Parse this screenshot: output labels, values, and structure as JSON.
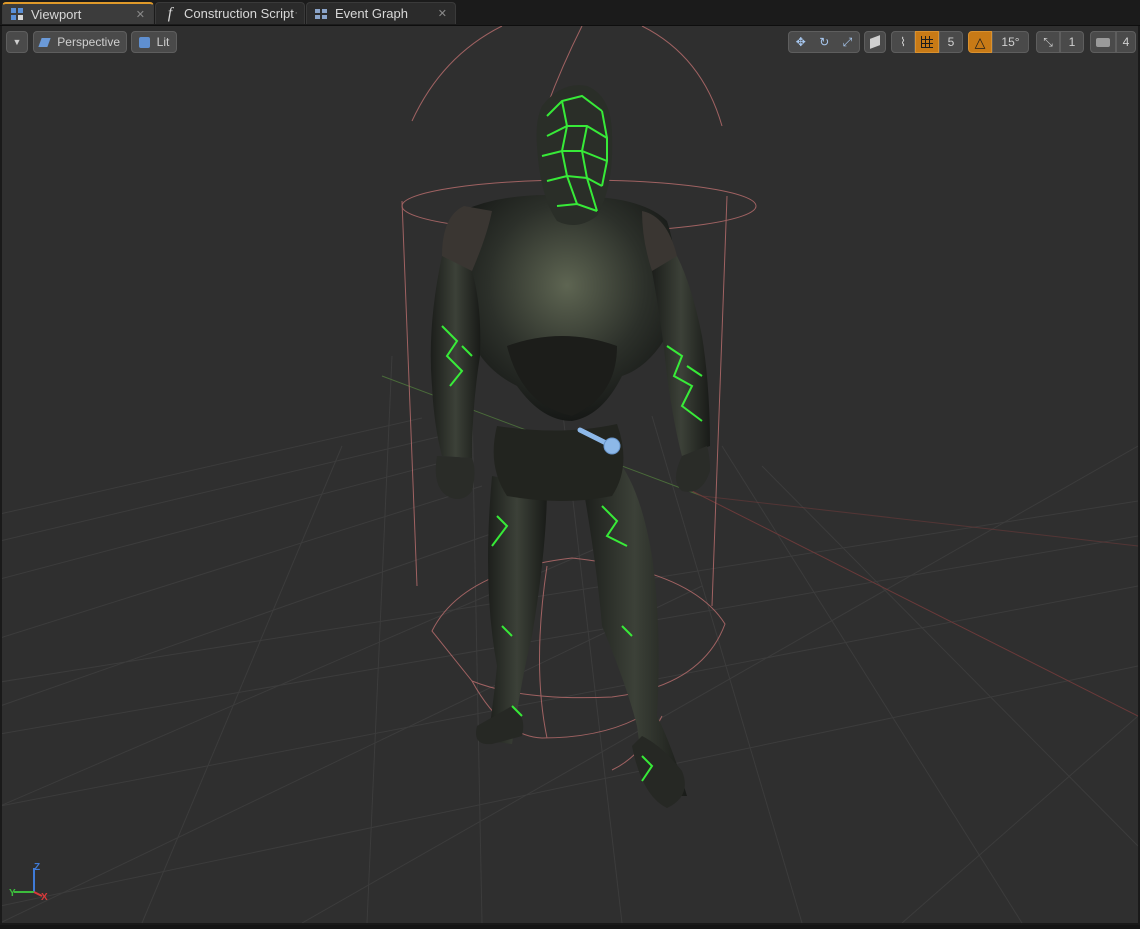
{
  "tabs": [
    {
      "label": "Viewport",
      "icon": "viewport-icon",
      "active": true
    },
    {
      "label": "Construction Script",
      "icon": "function-icon",
      "active": false
    },
    {
      "label": "Event Graph",
      "icon": "graph-icon",
      "active": false
    }
  ],
  "toolbar": {
    "view_mode_label": "Perspective",
    "lighting_label": "Lit",
    "grid_snap_value": "5",
    "rotation_snap_value": "15°",
    "scale_snap_value": "1",
    "camera_speed_value": "4"
  },
  "axis_gizmo": {
    "x": "X",
    "y": "Y",
    "z": "Z"
  },
  "colors": {
    "accent": "#e09a2a",
    "snap_active": "#c87a16",
    "capsule_wire": "#c47c7c",
    "glow": "#39ff3a"
  }
}
